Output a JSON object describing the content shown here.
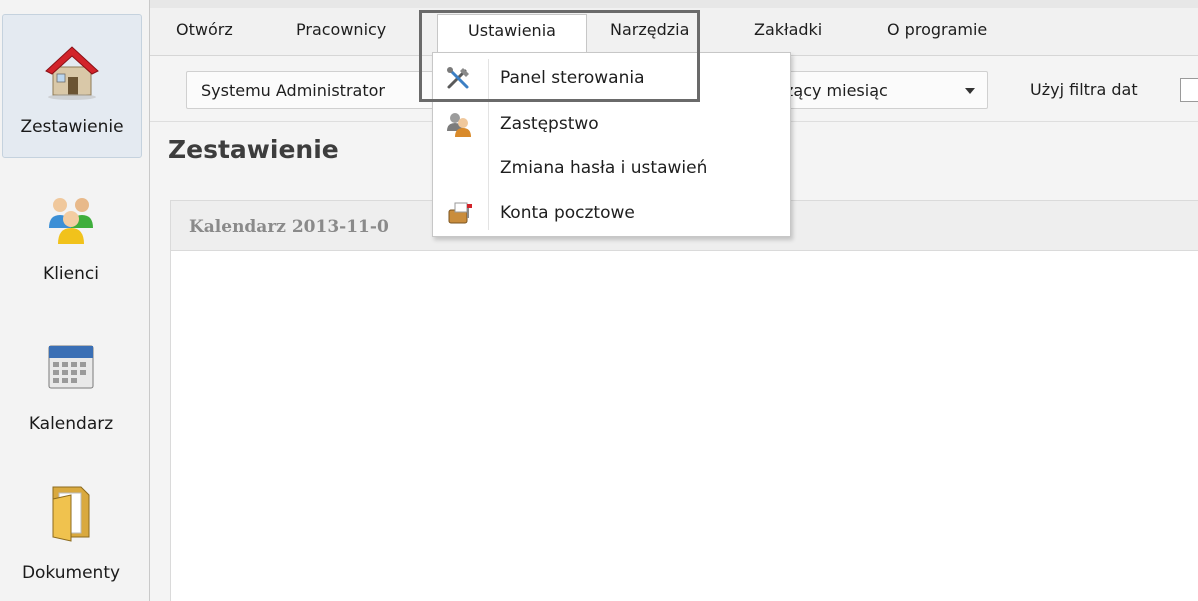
{
  "sidebar": {
    "items": [
      {
        "label": "Zestawienie",
        "icon": "house-icon",
        "active": true
      },
      {
        "label": "Klienci",
        "icon": "people-icon"
      },
      {
        "label": "Kalendarz",
        "icon": "calendar-icon"
      },
      {
        "label": "Dokumenty",
        "icon": "folder-icon"
      }
    ]
  },
  "menubar": {
    "items": [
      "Otwórz",
      "Pracownicy",
      "Ustawienia",
      "Narzędzia",
      "Zakładki",
      "O programie"
    ],
    "open_item": "Ustawienia"
  },
  "dropdown": {
    "items": [
      {
        "label": "Panel sterowania",
        "icon": "tools-icon"
      },
      {
        "label": "Zastępstwo",
        "icon": "users-substitute-icon"
      },
      {
        "label": "Zmiana hasła i ustawień",
        "icon": ""
      },
      {
        "label": "Konta pocztowe",
        "icon": "mailbox-icon"
      }
    ]
  },
  "toolbar": {
    "user_combo_value": "Systemu Administrator",
    "period_combo_value": "żący miesiąc",
    "date_filter_label": "Użyj filtra dat"
  },
  "page": {
    "title": "Zestawienie",
    "panel_title": "Kalendarz  2013-11-0"
  },
  "colors": {
    "sidebar_bg": "#f3f3f3",
    "active_item_bg": "#e4eaf1",
    "highlight_box": "#6a6a6a",
    "house_roof": "#d2232a"
  }
}
